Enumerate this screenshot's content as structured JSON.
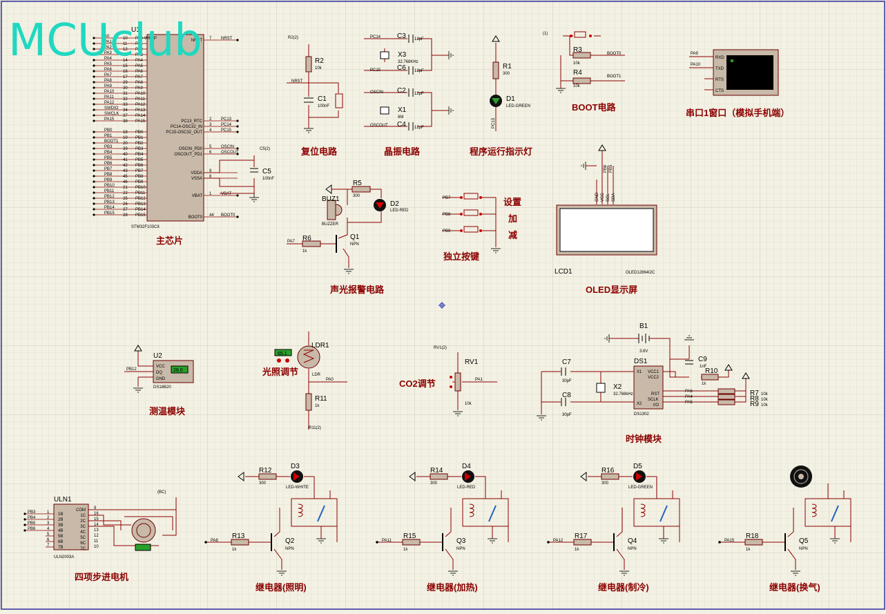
{
  "logo": "MCUclub",
  "sections": {
    "main_chip": "主芯片",
    "reset": "复位电路",
    "crystal": "晶振电路",
    "run_led": "程序运行指示灯",
    "boot": "BOOT电路",
    "uart": "串口1窗口（模拟手机端）",
    "alarm": "声光报警电路",
    "keys": "独立按键",
    "oled": "OLED显示屏",
    "temp": "测温模块",
    "light": "光照调节",
    "co2": "CO2调节",
    "clock": "时钟模块",
    "stepper": "四项步进电机",
    "relay1": "继电器(照明)",
    "relay2": "继电器(加热)",
    "relay3": "继电器(制冷)",
    "relay4": "继电器(换气)"
  },
  "key_labels": {
    "set": "设置",
    "add": "加",
    "sub": "减"
  },
  "mcu": {
    "ref": "U1",
    "part": "STM32F103C8",
    "left_pins": [
      "PA0-WKUP",
      "PA1",
      "PA2",
      "PA3",
      "PA4",
      "PA5",
      "PA6",
      "PA7",
      "PA8",
      "PA9",
      "PA10",
      "PA11",
      "PA12",
      "PA13",
      "PA14",
      "PA15",
      "",
      "PB0",
      "PB1",
      "PB2",
      "PB3",
      "PB4",
      "PB5",
      "PB6",
      "PB7",
      "PB8",
      "PB9",
      "PB10",
      "PB11",
      "PB12",
      "PB13",
      "PB14",
      "PB15"
    ],
    "left_nets": [
      "A0",
      "PA1",
      "PA2",
      "PA3",
      "PA4",
      "PA5",
      "PA6",
      "PA7",
      "PA8",
      "PA9",
      "PA10",
      "PA11",
      "PA12",
      "SWDIO",
      "SWCLK",
      "PA15",
      "",
      "PB0",
      "PB1",
      "BOOT1",
      "PB3",
      "PB4",
      "PB5",
      "PB6",
      "PB7",
      "PB8",
      "PB9",
      "PB10",
      "PB11",
      "PB12",
      "PB13",
      "PB14",
      "PB15"
    ],
    "left_nums": [
      "10",
      "11",
      "12",
      "13",
      "14",
      "15",
      "16",
      "17",
      "29",
      "30",
      "31",
      "32",
      "33",
      "34",
      "37",
      "38",
      "",
      "18",
      "19",
      "20",
      "39",
      "40",
      "41",
      "42",
      "43",
      "45",
      "46",
      "21",
      "22",
      "25",
      "26",
      "27",
      "28"
    ],
    "right_pins": [
      {
        "name": "NRST",
        "num": "7",
        "net": "NRST"
      },
      {
        "name": "PC13_RTC",
        "num": "2",
        "net": "PC13"
      },
      {
        "name": "PC14-OSC32_IN",
        "num": "3",
        "net": "PC14"
      },
      {
        "name": "PC15-OSC32_OUT",
        "num": "4",
        "net": "PC15"
      },
      {
        "name": "OSCIN_PD0",
        "num": "5",
        "net": "OSCIN"
      },
      {
        "name": "OSCOUT_PD1",
        "num": "6",
        "net": "OSCOUT"
      },
      {
        "name": "VDDA",
        "num": "9",
        "net": ""
      },
      {
        "name": "VSSA",
        "num": "8",
        "net": ""
      },
      {
        "name": "VBAT",
        "num": "1",
        "net": "VBAT"
      },
      {
        "name": "BOOT0",
        "num": "44",
        "net": "BOOT0"
      }
    ]
  },
  "parts": {
    "R1": {
      "ref": "R1",
      "val": "300"
    },
    "R2": {
      "ref": "R2",
      "val": "10k"
    },
    "R3": {
      "ref": "R3",
      "val": "10k"
    },
    "R4": {
      "ref": "R4",
      "val": "10k"
    },
    "R5": {
      "ref": "R5",
      "val": "300"
    },
    "R6": {
      "ref": "R6",
      "val": "1k"
    },
    "R10": {
      "ref": "R10",
      "val": "1k"
    },
    "R11": {
      "ref": "R11",
      "val": "1k"
    },
    "R7": {
      "ref": "R7",
      "val": "10k"
    },
    "R8": {
      "ref": "R8",
      "val": "10k"
    },
    "R9": {
      "ref": "R9",
      "val": "10k"
    },
    "C1": {
      "ref": "C1",
      "val": "100nF"
    },
    "C3": {
      "ref": "C3",
      "val": "12pF"
    },
    "C6": {
      "ref": "C6",
      "val": "12pF"
    },
    "C2": {
      "ref": "C2",
      "val": "12pF"
    },
    "C4": {
      "ref": "C4",
      "val": "12pF"
    },
    "C5": {
      "ref": "C5",
      "val": "100nF"
    },
    "C7": {
      "ref": "C7",
      "val": "30pF"
    },
    "C8": {
      "ref": "C8",
      "val": "30pF"
    },
    "C9": {
      "ref": "C9",
      "val": "1nF"
    },
    "X3": {
      "ref": "X3",
      "val": "32.768KHz"
    },
    "X1": {
      "ref": "X1",
      "val": "8M"
    },
    "X2": {
      "ref": "X2",
      "val": "32.768kHz"
    },
    "D1": {
      "ref": "D1",
      "val": "LED-GREEN"
    },
    "D2": {
      "ref": "D2",
      "val": "LED-RED"
    },
    "BUZ1": {
      "ref": "BUZ1",
      "val": "BUZZER"
    },
    "Q1": {
      "ref": "Q1",
      "val": "NPN"
    },
    "LCD1": {
      "ref": "LCD1",
      "val": "OLED12864I2C"
    },
    "U2": {
      "ref": "U2",
      "val": "DS18B20",
      "reading": "28.0"
    },
    "LDR1": {
      "ref": "LDR1",
      "val": "LDR",
      "reading": "65.1"
    },
    "RV1": {
      "ref": "RV1",
      "val": "10k"
    },
    "DS1": {
      "ref": "DS1",
      "val": "DS1302"
    },
    "B1": {
      "ref": "B1",
      "val": "3.6V"
    },
    "ULN1": {
      "ref": "ULN1",
      "val": "ULN2003A"
    }
  },
  "nets": {
    "r2_probe": "R2(2)",
    "c5_probe": "C5(2)",
    "boot_probe": "(1)",
    "rv1_probe": "RV1(2)",
    "r11_probe": "R11(2)",
    "bc_probe": "(BC)",
    "pa9": "PA9",
    "pa10": "PA10",
    "pa7": "PA7",
    "pb7": "PB7",
    "pb8": "PB8",
    "pb9": "PB9",
    "pb12": "PB12",
    "pa0": "PA0",
    "pa1": "PA1",
    "pa6": "PA6",
    "pa4": "PA4",
    "pa5": "PA5",
    "pc13": "PC13",
    "boot0": "BOOT0",
    "boot1": "BOOT1"
  },
  "terminal_pins": [
    "RXD",
    "TXD",
    "RTS",
    "CTS"
  ],
  "oled_pins": [
    "GND",
    "VCC",
    "SCL",
    "SDA"
  ],
  "oled_pin_nets": [
    "PB6",
    "PB5"
  ],
  "ds1302_pins": {
    "x1": "X1",
    "x2": "X2",
    "vcc1": "VCC1",
    "vcc2": "VCC2",
    "rst": "RST",
    "sclk": "SCLK",
    "io": "I/O"
  },
  "ds18b20_pins": [
    "VCC",
    "DQ",
    "GND"
  ],
  "uln_pins_left": [
    "1B",
    "2B",
    "3B",
    "4B",
    "5B",
    "6B",
    "7B"
  ],
  "uln_pins_right": [
    "COM",
    "1C",
    "2C",
    "3C",
    "4C",
    "5C",
    "6C",
    "7C"
  ],
  "uln_inputs": [
    "PB3",
    "PB4",
    "PB5",
    "PB6"
  ],
  "relays": [
    {
      "r_led": "R12",
      "r_led_val": "300",
      "led": "D3",
      "led_val": "LED-WHITE",
      "r_base": "R13",
      "r_base_val": "1k",
      "q": "Q2",
      "q_val": "NPN",
      "net": "PA8"
    },
    {
      "r_led": "R14",
      "r_led_val": "300",
      "led": "D4",
      "led_val": "LED-RED",
      "r_base": "R15",
      "r_base_val": "1k",
      "q": "Q3",
      "q_val": "NPN",
      "net": "PA11"
    },
    {
      "r_led": "R16",
      "r_led_val": "300",
      "led": "D5",
      "led_val": "LED-GREEN",
      "r_base": "R17",
      "r_base_val": "1k",
      "q": "Q4",
      "q_val": "NPN",
      "net": "PA12"
    },
    {
      "r_led": "",
      "r_led_val": "",
      "led": "",
      "led_val": "",
      "r_base": "R18",
      "r_base_val": "1k",
      "q": "Q5",
      "q_val": "NPN",
      "net": "PA15"
    }
  ],
  "colors": {
    "background": "#f3f1e3",
    "grid": "#d8d6c8",
    "wire": "#8b0000",
    "component_body": "#c9b9a8",
    "label": "#8b0000",
    "logo": "#20d8c0"
  }
}
